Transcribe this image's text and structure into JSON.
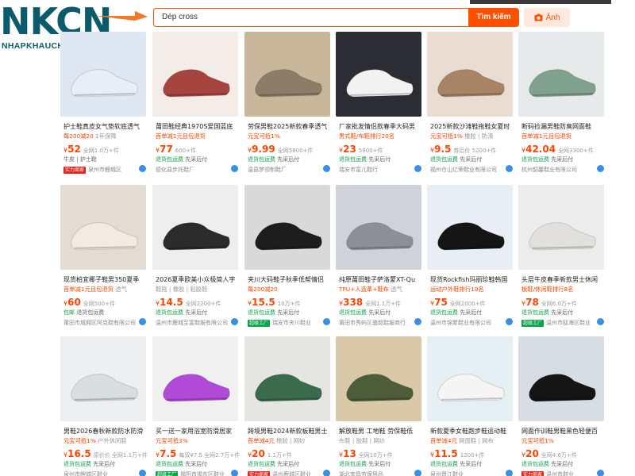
{
  "logo": {
    "main": "NKCN",
    "sub": "NHAPKHAUCHINHNGACH"
  },
  "search": {
    "value": "Dép cross",
    "button": "Tìm kiếm",
    "image_button": "Ảnh"
  },
  "products": [
    {
      "title": "护士鞋真皮女气垫软底透气",
      "tag_hot": "每200减20",
      "tag_rest": "1年保障",
      "price": "52",
      "sold": "全网1.0万+件",
      "svc_green": "",
      "svc_rest": "牛皮 | 护士鞋",
      "badge": "实力商家",
      "shop": "泉州市鲤城区",
      "thumb": "#dfe7f3",
      "shoe": "#e8eef8"
    },
    {
      "title": "莆田鞋经典1970S爱国蓝底",
      "tag_hot": "首单减1元且包退货",
      "tag_rest": "",
      "price": "77",
      "sold": "600+件",
      "svc_green": "退货包运费",
      "svc_rest": "先采后付",
      "badge": "",
      "shop": "德化县步托鞋厂",
      "thumb": "#f3ece7",
      "shoe": "#a8443f"
    },
    {
      "title": "劳保男鞋2025新款春季透气",
      "tag_hot": "元宝可抵1%",
      "tag_rest": "",
      "price": "9.99",
      "sold": "全网5800+件",
      "svc_green": "退货包运费",
      "svc_rest": "先采后付",
      "badge": "",
      "shop": "温县梦领制鞋厂",
      "thumb": "#c9b79c",
      "shoe": "#8d7d66"
    },
    {
      "title": "厂家批发情侣款春季大码男",
      "tag_hot": "男式鞋/布鞋排行20名",
      "tag_rest": "",
      "price": "23",
      "sold": "5900+件",
      "svc_green": "退货包运费",
      "svc_rest": "先采后付",
      "badge": "",
      "shop": "瑞安市富儿鞋行",
      "thumb": "#2c2c33",
      "shoe": "#f2f2f2"
    },
    {
      "title": "2025新款沙滩鞋拖鞋女夏时",
      "tag_hot": "元宝可抵1%",
      "tag_rest": "橡胶 | 防滑",
      "price": "9.5",
      "sold": "券后价 5200+件",
      "svc_green": "退货包运费",
      "svc_rest": "先采后付",
      "badge": "",
      "shop": "福州仓山亿荣鞋业有限公司",
      "thumb": "#e9ddd1",
      "shoe": "#a78466"
    },
    {
      "title": "断码捡漏男鞋防臭网面鞋",
      "tag_hot": "首单减1元且包退货",
      "tag_rest": "",
      "price": "42.04",
      "sold": "全网3300+件",
      "svc_green": "退货包运费",
      "svc_rest": "先采后付",
      "badge": "",
      "shop": "杭州韶馨鞋业有限公司",
      "thumb": "#e7eaea",
      "shoe": "#7fa18d"
    },
    {
      "title": "现货柏宜椰子鞋男350夏季",
      "tag_hot": "首单减1元且包退货",
      "tag_rest": "透气",
      "price": "60",
      "sold": "全网500+件",
      "svc_green": "包邮",
      "svc_rest": "退货包运费",
      "badge": "",
      "shop": "莆田市城厢区阿克鞋有限公司",
      "thumb": "#e2dcd3",
      "shoe": "#f1ece2"
    },
    {
      "title": "2026夏季欧美小众极简人字",
      "tag_hot": "",
      "tag_rest": "鞋拖 | 橡胶 | 粘胶鞋",
      "price": "14.5",
      "sold": "全网2200+件",
      "svc_green": "退货包运费",
      "svc_rest": "先采后付",
      "badge": "",
      "shop": "温州市鹿城至富鞋服有限公司",
      "thumb": "#eeeeee",
      "shoe": "#2b2b2b"
    },
    {
      "title": "夹川大码鞋子秋季低帮情侣",
      "tag_hot": "每200减20",
      "tag_rest": "",
      "price": "15.5",
      "sold": "10万+件",
      "svc_green": "退货包运费",
      "svc_rest": "先采后付",
      "badge": "超级工厂",
      "shop": "瑞安市夹川鞋业",
      "thumb": "#d9d9d9",
      "shoe": "#1d1d1d"
    },
    {
      "title": "纯原莆田鞋子萨洛蒙XT-Qu",
      "tag_hot": "TPU+人造革+鞋布",
      "tag_rest": "透气",
      "price": "338",
      "sold": "全网1.1万+件",
      "svc_green": "退货包运费",
      "svc_rest": "先采后付",
      "badge": "",
      "shop": "莆田市秀屿区盛超鞋服商行",
      "thumb": "#cfd2d6",
      "shoe": "#8c9096"
    },
    {
      "title": "现货Rockfish玛丽珍鞋韩国",
      "tag_hot": "运动户外鞋排行19名",
      "tag_rest": "",
      "price": "75",
      "sold": "全网2000+件",
      "svc_green": "退货包运费",
      "svc_rest": "先采后付",
      "badge": "",
      "shop": "温州市锦聚鞋业有限公司",
      "thumb": "#e8eef3",
      "shoe": "#151515"
    },
    {
      "title": "头层牛皮春季新款男士休闲",
      "tag_hot": "板鞋/休闲鞋排行8名",
      "tag_rest": "",
      "price": "78",
      "sold": "全网6.0万+件",
      "svc_green": "退货包运费",
      "svc_rest": "先采后付",
      "badge": "超级工厂",
      "shop": "温州市瓯海区鞋业",
      "thumb": "#ececec",
      "shoe": "#e2e0dc"
    },
    {
      "title": "男鞋2026春秋新款防水防滑",
      "tag_hot": "元宝可抵1%",
      "tag_rest": "户外休闲鞋",
      "price": "16.5",
      "sold": "原价价 全网1.1万+件",
      "svc_green": "退货包运费",
      "svc_rest": "先采后付",
      "badge": "",
      "shop": "泉州市鲤城区鞋业",
      "thumb": "#edeff0",
      "shoe": "#d8dde0"
    },
    {
      "title": "买一送一家用浴室防滑居家",
      "tag_hot": "元宝可抵3%",
      "tag_rest": "",
      "price": "7.5",
      "sold": "每双¥7.5 全网2.7万+件",
      "svc_green": "退货包运费",
      "svc_rest": "先采后付",
      "badge": "超级工厂",
      "shop": "揭阳市揭东区鞋业",
      "thumb": "#f0f0f0",
      "shoe": "#b04ad7"
    },
    {
      "title": "跨境男鞋2024新款板鞋男士",
      "tag_hot": "首单减4元",
      "tag_rest": "橡胶 | 网纱",
      "price": "20",
      "sold": "1.1万+件",
      "svc_green": "退货包运费",
      "svc_rest": "先采后付",
      "badge": "实力商家",
      "shop": "温州鹿城区鞋业",
      "thumb": "#e5e6e2",
      "shoe": "#3a6b4a"
    },
    {
      "title": "解放鞋男 工地鞋 劳保鞋低",
      "tag_hot": "",
      "tag_rest": "布鞋 | 胶鞋 | 网纱",
      "price": "13",
      "sold": "全网10万+件",
      "svc_green": "退货包运费",
      "svc_rest": "先采后付",
      "badge": "",
      "shop": "湖北宜昌劳保用品",
      "thumb": "#d9c9a8",
      "shoe": "#4d5d3a"
    },
    {
      "title": "新款夏季女鞋跑步鞋运动鞋",
      "tag_hot": "首单减4元",
      "tag_rest": "网面鞋 | 网布",
      "price": "11.5",
      "sold": "1200+件",
      "svc_green": "退货包运费",
      "svc_rest": "先采后付",
      "badge": "",
      "shop": "泉州晋江鞋业",
      "thumb": "#e6f0f4",
      "shoe": "#f5f5f5"
    },
    {
      "title": "网面作训鞋男鞋黑色轻便百",
      "tag_hot": "元宝可抵1%",
      "tag_rest": "",
      "price": "20",
      "sold": "全网4.6万+件",
      "svc_green": "退货包运费",
      "svc_rest": "先采后付",
      "badge": "实力商家",
      "shop": "温州市鞋业",
      "thumb": "#d7dde3",
      "shoe": "#151515"
    }
  ]
}
